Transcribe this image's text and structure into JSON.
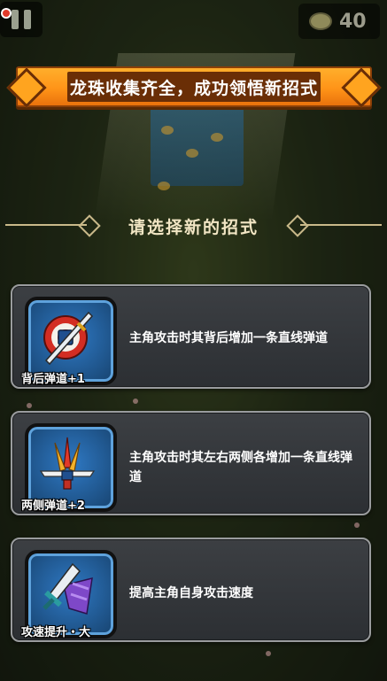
{
  "hud": {
    "pause_icon": "pause-icon",
    "coin_icon": "coin-icon",
    "coin_count": "40"
  },
  "banner": {
    "title": "龙珠收集齐全，成功领悟新招式"
  },
  "prompt": {
    "text": "请选择新的招式"
  },
  "skills": [
    {
      "icon": "target-sword-icon",
      "name": "背后弹道+1",
      "description": "主角攻击时其背后增加一条直线弹道"
    },
    {
      "icon": "triple-sword-icon",
      "name": "两侧弹道+2",
      "description": "主角攻击时其左右两侧各增加一条直线弹道"
    },
    {
      "icon": "sword-speed-icon",
      "name": "攻速提升・大",
      "description": "提高主角自身攻击速度"
    }
  ],
  "colors": {
    "banner_orange": "#ff9418",
    "banner_brown": "#6a2e06",
    "card_bg": "#34373b",
    "icon_blue": "#2f79c4",
    "prompt_text": "#f2e6c4"
  }
}
